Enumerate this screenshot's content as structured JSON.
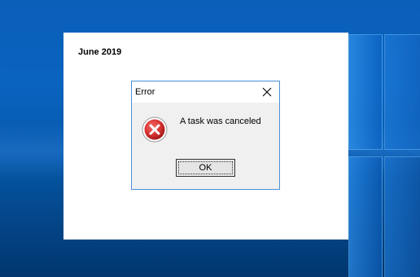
{
  "desktop": {
    "accent_color": "#0a5fb8",
    "logo_icon": "windows-logo-icon"
  },
  "app": {
    "date_label": "June 2019"
  },
  "dialog": {
    "title": "Error",
    "close_icon": "close-icon",
    "icon": "error-icon",
    "icon_color": "#d93434",
    "message": "A task was canceled",
    "ok_label": "OK"
  }
}
